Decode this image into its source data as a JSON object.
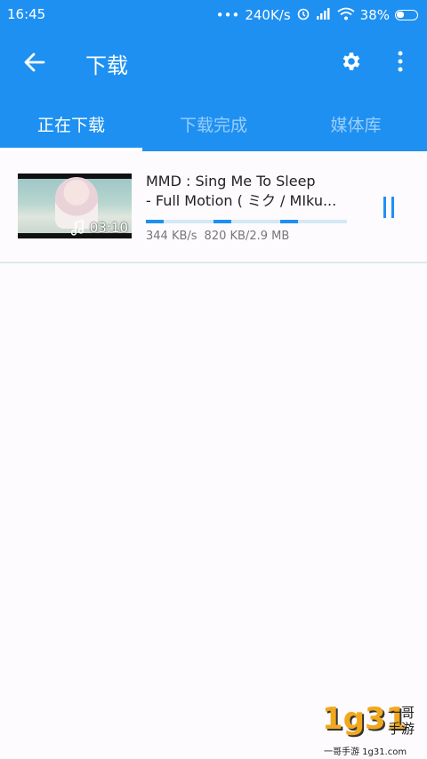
{
  "status_bar": {
    "time": "16:45",
    "dots": "•••",
    "speed": "240K/s",
    "battery": "38%"
  },
  "toolbar": {
    "title": "下载"
  },
  "tabs": [
    {
      "label": "正在下载",
      "active": true
    },
    {
      "label": "下载完成",
      "active": false
    },
    {
      "label": "媒体库",
      "active": false
    }
  ],
  "downloads": [
    {
      "title_line1": "MMD : Sing Me To Sleep",
      "title_line2": "- Full Motion ( ミク / MIku...",
      "duration": "03:10",
      "speed": "344 KB/s",
      "size": "820 KB/2.9 MB",
      "progress": 0.28
    }
  ],
  "watermark": {
    "number": "1g31",
    "chars": "一哥手游",
    "url": "一哥手游 1g31.com"
  },
  "colors": {
    "primary": "#1e90f2",
    "background": "#fdfbfd",
    "divider": "#dde9ec"
  }
}
